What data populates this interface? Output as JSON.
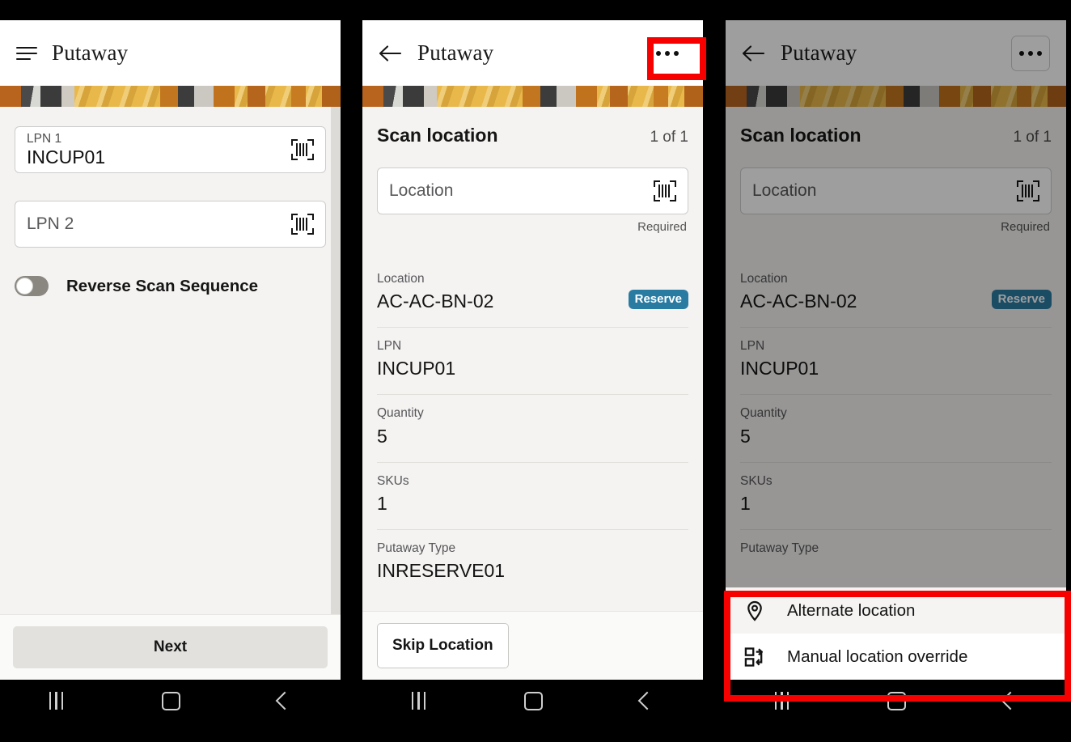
{
  "nav": {
    "recent": "recent-apps",
    "home": "home",
    "back": "back"
  },
  "panel1": {
    "appbar": {
      "menu_icon": "hamburger-menu-icon",
      "title": "Putaway"
    },
    "fields": [
      {
        "label": "LPN 1",
        "value": "INCUP01",
        "placeholder": "",
        "scan_icon": "barcode-scan-icon"
      },
      {
        "label": "",
        "value": "",
        "placeholder": "LPN 2",
        "scan_icon": "barcode-scan-icon"
      }
    ],
    "toggle": {
      "label": "Reverse Scan Sequence",
      "state": "off"
    },
    "primary_button": "Next"
  },
  "panel2": {
    "appbar": {
      "back_icon": "back-arrow-icon",
      "title": "Putaway",
      "overflow_icon": "more-options-icon"
    },
    "section": {
      "title": "Scan location",
      "count": "1 of 1"
    },
    "location_input": {
      "placeholder": "Location",
      "value": "",
      "helper": "Required",
      "scan_icon": "barcode-scan-icon"
    },
    "details": [
      {
        "label": "Location",
        "value": "AC-AC-BN-02",
        "badge": "Reserve"
      },
      {
        "label": "LPN",
        "value": "INCUP01",
        "badge": ""
      },
      {
        "label": "Quantity",
        "value": "5",
        "badge": ""
      },
      {
        "label": "SKUs",
        "value": "1",
        "badge": ""
      },
      {
        "label": "Putaway Type",
        "value": "INRESERVE01",
        "badge": ""
      }
    ],
    "skip_button": "Skip Location"
  },
  "panel3": {
    "appbar": {
      "back_icon": "back-arrow-icon",
      "title": "Putaway",
      "overflow_icon": "more-options-icon"
    },
    "section": {
      "title": "Scan location",
      "count": "1 of 1"
    },
    "location_input": {
      "placeholder": "Location",
      "value": "",
      "helper": "Required",
      "scan_icon": "barcode-scan-icon"
    },
    "details": [
      {
        "label": "Location",
        "value": "AC-AC-BN-02",
        "badge": "Reserve"
      },
      {
        "label": "LPN",
        "value": "INCUP01",
        "badge": ""
      },
      {
        "label": "Quantity",
        "value": "5",
        "badge": ""
      },
      {
        "label": "SKUs",
        "value": "1",
        "badge": ""
      },
      {
        "label": "Putaway Type",
        "value": "",
        "badge": ""
      }
    ],
    "popup_menu": [
      {
        "label": "Alternate location",
        "icon": "map-pin-icon"
      },
      {
        "label": "Manual location override",
        "icon": "manual-override-icon"
      }
    ]
  },
  "colors": {
    "badge_reserve": "#2a7ba2",
    "highlight": "#f70000",
    "screen_bg": "#f4f3f1",
    "appbar_bg": "#ffffff"
  }
}
